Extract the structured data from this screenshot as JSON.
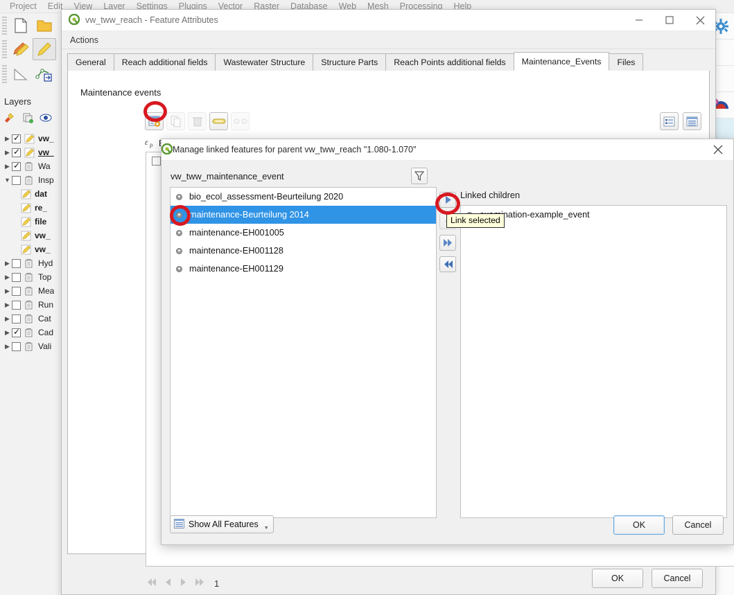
{
  "qgis": {
    "menus": [
      "Project",
      "Edit",
      "View",
      "Layer",
      "Settings",
      "Plugins",
      "Vector",
      "Raster",
      "Database",
      "Web",
      "Mesh",
      "Processing",
      "Help"
    ],
    "layers_panel_title": "Layers",
    "layer_tree": [
      {
        "label": "vw_",
        "checked": true,
        "expandable": true,
        "bold": true,
        "underline": false,
        "icon": "edit-pencil-icon",
        "child": false
      },
      {
        "label": "vw_",
        "checked": true,
        "expandable": true,
        "bold": true,
        "underline": true,
        "icon": "edit-pencil-icon",
        "child": false
      },
      {
        "label": "Wa",
        "checked": true,
        "expandable": true,
        "bold": false,
        "underline": false,
        "icon": "group-layer-icon",
        "child": false
      },
      {
        "label": "Insp",
        "checked": false,
        "expandable": true,
        "expanded": true,
        "bold": false,
        "underline": false,
        "icon": "group-layer-icon",
        "child": false
      },
      {
        "label": "dat",
        "checked": null,
        "expandable": false,
        "bold": true,
        "underline": false,
        "icon": "edit-pencil-icon",
        "child": true
      },
      {
        "label": "re_",
        "checked": null,
        "expandable": false,
        "bold": true,
        "underline": false,
        "icon": "edit-pencil-icon",
        "child": true
      },
      {
        "label": "file",
        "checked": null,
        "expandable": false,
        "bold": true,
        "underline": false,
        "icon": "edit-pencil-icon",
        "child": true
      },
      {
        "label": "vw_",
        "checked": null,
        "expandable": false,
        "bold": true,
        "underline": false,
        "icon": "edit-pencil-icon",
        "child": true
      },
      {
        "label": "vw_",
        "checked": null,
        "expandable": false,
        "bold": true,
        "underline": false,
        "icon": "edit-pencil-icon",
        "child": true
      },
      {
        "label": "Hyd",
        "checked": false,
        "expandable": true,
        "bold": false,
        "underline": false,
        "icon": "group-layer-icon",
        "child": false
      },
      {
        "label": "Top",
        "checked": false,
        "expandable": true,
        "bold": false,
        "underline": false,
        "icon": "group-layer-icon",
        "child": false
      },
      {
        "label": "Mea",
        "checked": false,
        "expandable": true,
        "bold": false,
        "underline": false,
        "icon": "group-layer-icon",
        "child": false
      },
      {
        "label": "Run",
        "checked": false,
        "expandable": true,
        "bold": false,
        "underline": false,
        "icon": "group-layer-icon",
        "child": false
      },
      {
        "label": "Cat",
        "checked": false,
        "expandable": true,
        "bold": false,
        "underline": false,
        "icon": "group-layer-icon",
        "child": false
      },
      {
        "label": "Cad",
        "checked": true,
        "expandable": true,
        "bold": false,
        "underline": false,
        "icon": "group-layer-icon",
        "child": false
      },
      {
        "label": "Vali",
        "checked": false,
        "expandable": true,
        "bold": false,
        "underline": false,
        "icon": "group-layer-icon",
        "child": false
      }
    ]
  },
  "feature_window": {
    "title": "vw_tww_reach - Feature Attributes",
    "actions_menu": "Actions",
    "minimize_icon": "minimize-icon",
    "maximize_icon": "maximize-icon",
    "close_icon": "close-icon",
    "tabs": [
      {
        "label": "General",
        "selected": false
      },
      {
        "label": "Reach additional fields",
        "selected": false
      },
      {
        "label": "Wastewater Structure",
        "selected": false
      },
      {
        "label": "Structure Parts",
        "selected": false
      },
      {
        "label": "Reach Points additional fields",
        "selected": false
      },
      {
        "label": "Maintenance_Events",
        "selected": true
      },
      {
        "label": "Files",
        "selected": false
      }
    ],
    "section_label": "Maintenance events",
    "toolbar": [
      {
        "name": "toggle-editing-button",
        "icon": "form-view-icon",
        "disabled": false
      },
      {
        "name": "duplicate-feature-button",
        "icon": "copy-feature-icon",
        "disabled": true
      },
      {
        "name": "delete-child-feature-button",
        "icon": "trash-icon",
        "disabled": true
      },
      {
        "name": "link-feature-button",
        "icon": "link-icon",
        "disabled": false,
        "highlighted": true
      },
      {
        "name": "unlink-feature-button",
        "icon": "unlink-icon",
        "disabled": true
      }
    ],
    "view_buttons": [
      {
        "name": "form-view-toggle",
        "icon": "form-view-icon"
      },
      {
        "name": "table-view-toggle",
        "icon": "table-view-icon"
      }
    ],
    "expression_label": "Expression",
    "expression_icon": "epsilon-expression-icon",
    "child_rows": [
      {
        "value": "examination-e",
        "checked": false
      }
    ],
    "page_nav": {
      "first_icon": "first-page-icon",
      "prev_icon": "previous-page-icon",
      "next_icon": "next-page-icon",
      "last_icon": "last-page-icon",
      "page_number": "1"
    },
    "ok_label": "OK",
    "cancel_label": "Cancel"
  },
  "link_dialog": {
    "title": "Manage linked features for parent vw_tww_reach \"1.080-1.070\"",
    "close_icon": "close-icon",
    "source_label": "vw_tww_maintenance_event",
    "filter_icon": "filter-funnel-icon",
    "source_items": [
      {
        "label": "bio_ecol_assessment-Beurteilung 2020",
        "selected": false
      },
      {
        "label": "maintenance-Beurteilung 2014",
        "selected": true
      },
      {
        "label": "maintenance-EH001005",
        "selected": false
      },
      {
        "label": "maintenance-EH001128",
        "selected": false
      },
      {
        "label": "maintenance-EH001129",
        "selected": false
      }
    ],
    "transfer_buttons": [
      {
        "name": "link-selected-button",
        "icon": "arrow-right-icon",
        "dim": false
      },
      {
        "name": "unlink-selected-button",
        "icon": "arrow-left-icon",
        "dim": true
      },
      {
        "name": "link-all-button",
        "icon": "double-arrow-right-icon",
        "dim": false
      },
      {
        "name": "unlink-all-button",
        "icon": "double-arrow-left-icon",
        "dim": false
      }
    ],
    "target_label": "Linked children",
    "target_items": [
      {
        "label": "examination-example_event",
        "selected": false
      }
    ],
    "show_all_label": "Show All Features",
    "show_all_icon": "table-view-icon",
    "ok_label": "OK",
    "cancel_label": "Cancel"
  },
  "tooltip": {
    "text": "Link selected"
  },
  "annotations": {
    "circle_color": "#d71920",
    "items": [
      "link-feature-button",
      "selected-list-item-bullet",
      "link-selected-arrow-button"
    ]
  }
}
